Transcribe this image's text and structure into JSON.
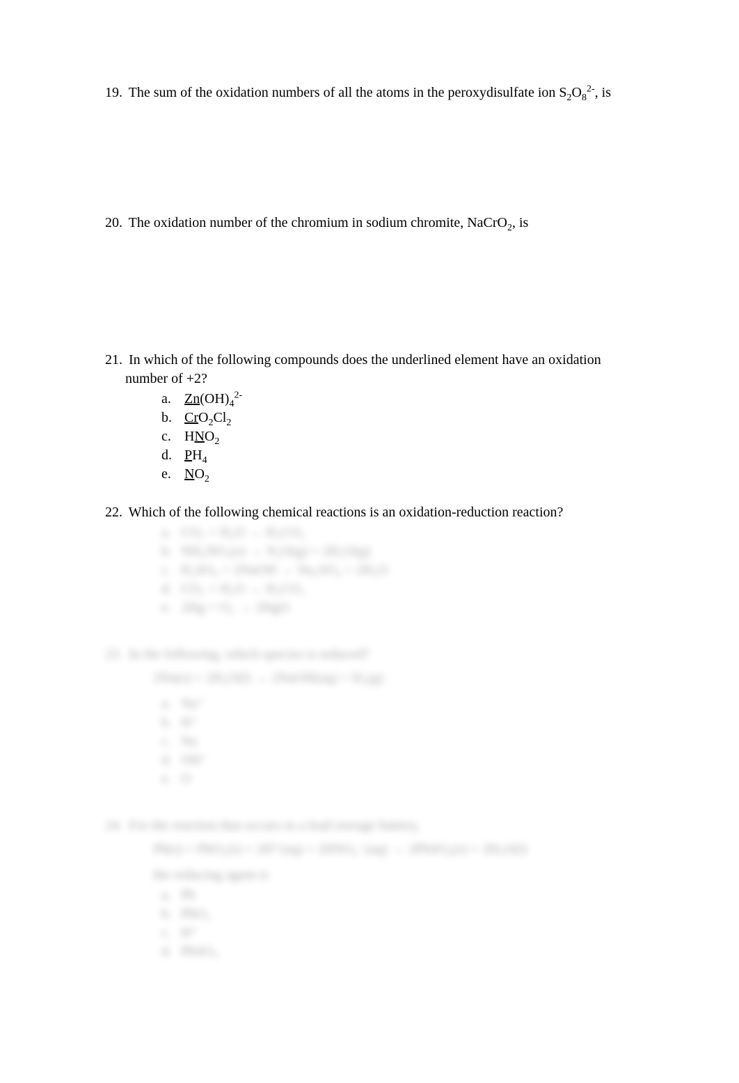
{
  "questions": {
    "q19": {
      "number": "19.",
      "text_pre": "The sum of the oxidation numbers of all the atoms in the peroxydisulfate ion S",
      "sub1": "2",
      "mid1": "O",
      "sub2": "8",
      "sup1": "2-",
      "text_post": ", is"
    },
    "q20": {
      "number": "20.",
      "text_pre": "The oxidation number of the chromium in sodium chromite, NaCrO",
      "sub1": "2",
      "text_post": ", is"
    },
    "q21": {
      "number": "21.",
      "text": "In which of the following compounds does the underlined element have an oxidation number of +2?",
      "options": {
        "a": {
          "letter": "a.",
          "u": "Zn",
          "post": "(OH)",
          "sub1": "4",
          "sup1": "2-"
        },
        "b": {
          "letter": "b.",
          "u": "Cr",
          "post": "O",
          "sub1": "2",
          "post2": "Cl",
          "sub2": "2"
        },
        "c": {
          "letter": "c.",
          "pre": "H",
          "u": "N",
          "post": "O",
          "sub1": "2"
        },
        "d": {
          "letter": "d.",
          "u": "P",
          "post": "H",
          "sub1": "4"
        },
        "e": {
          "letter": "e.",
          "u": "N",
          "post": "O",
          "sub1": "2"
        }
      }
    },
    "q22": {
      "number": "22.",
      "text": "Which of the following chemical reactions is an oxidation-reduction reaction?",
      "options": {
        "a": {
          "letter": "a.",
          "text": "CO₂ + H₂O → H₂CO₃"
        },
        "b": {
          "letter": "b.",
          "text": "NH₄NO₃(s) → N₂O(g) + 2H₂O(g)"
        },
        "c": {
          "letter": "c.",
          "text": "H₂SO₄ + 2NaOH → Na₂SO₄ + 2H₂O"
        },
        "d": {
          "letter": "d.",
          "text": "CO₂ + H₂O → H₂CO₃"
        },
        "e": {
          "letter": "e.",
          "text": "2Hg + O₂ → 2HgO"
        }
      }
    },
    "q23": {
      "number": "23.",
      "text": "In the following, which species is reduced?",
      "reaction": "2Na(s) + 2H₂O(l) → 2NaOH(aq) + H₂(g)",
      "options": {
        "a": {
          "letter": "a.",
          "text": "Na⁺"
        },
        "b": {
          "letter": "b.",
          "text": "H⁺"
        },
        "c": {
          "letter": "c.",
          "text": "Na"
        },
        "d": {
          "letter": "d.",
          "text": "OH⁻"
        },
        "e": {
          "letter": "e.",
          "text": "O"
        }
      }
    },
    "q24": {
      "number": "24.",
      "text": "For the reaction that occurs in a lead storage battery,",
      "reaction": "Pb(s) + PbO₂(s) + 2H⁺(aq) + 2HSO₄⁻(aq) → 2PbSO₄(s) + 2H₂O(l)",
      "sub_statement": "the reducing agent is",
      "options": {
        "a": {
          "letter": "a.",
          "text": "Pb"
        },
        "b": {
          "letter": "b.",
          "text": "PbO₂"
        },
        "c": {
          "letter": "c.",
          "text": "H⁺"
        },
        "d": {
          "letter": "d.",
          "text": "PbSO₄"
        }
      }
    }
  }
}
